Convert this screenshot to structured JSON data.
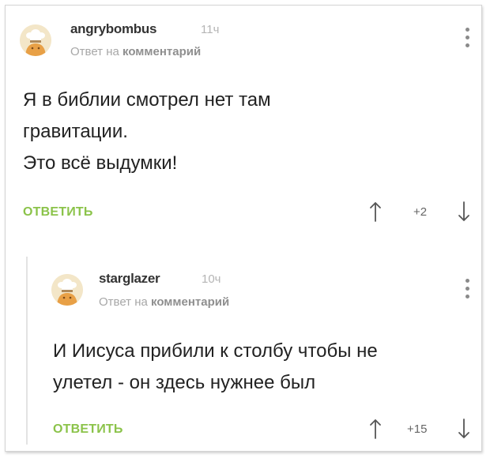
{
  "comments": [
    {
      "username": "angrybombus",
      "time": "11ч",
      "reply_prefix": "Ответ на",
      "reply_target": "комментарий",
      "text_lines": [
        "Я в библии смотрел нет там",
        "гравитации.",
        "Это всё выдумки!"
      ],
      "reply_label": "ОТВЕТИТЬ",
      "score": "+2"
    },
    {
      "username": "starglazer",
      "time": "10ч",
      "reply_prefix": "Ответ на",
      "reply_target": "комментарий",
      "text_lines": [
        "И Иисуса прибили к столбу чтобы не",
        "улетел - он здесь нужнее был"
      ],
      "reply_label": "ОТВЕТИТЬ",
      "score": "+15"
    }
  ],
  "icons": {
    "avatar": "chef-hat-avatar-icon",
    "menu": "more-vertical-icon",
    "upvote": "arrow-up-icon",
    "downvote": "arrow-down-icon"
  },
  "colors": {
    "reply_button": "#8bc34a",
    "avatar_bg": "#f3e6c8"
  }
}
